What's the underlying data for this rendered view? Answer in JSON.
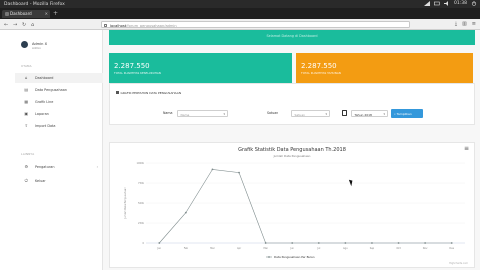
{
  "os": {
    "window_title": "Dashboard - Mozilla Firefox",
    "time": "01:38"
  },
  "browser": {
    "tab_label": "Dashboard",
    "url_host": "localhost",
    "url_path": "/forum_pengusahaan/admin"
  },
  "sidebar": {
    "user_name": "Admin X",
    "user_role": "Admin",
    "section_main": "UTAMA",
    "items": [
      {
        "label": "Dashboard",
        "icon": "home-icon"
      },
      {
        "label": "Data Pengusahaan",
        "icon": "database-icon"
      },
      {
        "label": "Grafik Line",
        "icon": "chart-icon"
      },
      {
        "label": "Laporan",
        "icon": "report-icon"
      },
      {
        "label": "Import Data",
        "icon": "upload-icon"
      }
    ],
    "section_settings": "LAINNYA",
    "settings_items": [
      {
        "label": "Pengaturan",
        "icon": "gear-icon"
      },
      {
        "label": "Keluar",
        "icon": "logout-icon"
      }
    ]
  },
  "main": {
    "banner_text": "Selamat Datang di Dashboard",
    "stats": [
      {
        "value": "2.287.550",
        "label": "TOTAL KUANTITAS KESELURUHAN",
        "color": "#1abc9c"
      },
      {
        "value": "2.287.550",
        "label": "TOTAL KUANTITAS TAHUNAN",
        "color": "#f39c12"
      }
    ],
    "filter": {
      "title": "GRAFIK PERTAHUN DATA PENGUSAHAAN",
      "name_label": "Nama",
      "name_placeholder": "Nama",
      "status_label": "Satuan",
      "status_placeholder": "Satuan",
      "year_value": "Tahun 2018",
      "submit_label": "Tampilkan"
    }
  },
  "chart_data": {
    "type": "line",
    "title": "Grafik Statistik Data Pengusahaan Th.2018",
    "subtitle": "Jumlah Data Pengusahaan",
    "ylabel": "Jumlah Data Pengusahaan",
    "categories": [
      "Jan",
      "Feb",
      "Mar",
      "Apr",
      "Mei",
      "Jun",
      "Jul",
      "Agu",
      "Sep",
      "Okt",
      "Nov",
      "Des"
    ],
    "y_ticks": [
      "0",
      "250k",
      "500k",
      "750k",
      "1000k"
    ],
    "ylim": [
      0,
      1000000
    ],
    "series": [
      {
        "name": "Data Pengusahaan Per Bulan",
        "values": [
          0,
          380000,
          920000,
          880000,
          0,
          0,
          0,
          0,
          0,
          0,
          0,
          0
        ],
        "color": "#7f8c8d"
      }
    ],
    "legend_position": "bottom",
    "credit": "Highcharts.com"
  }
}
